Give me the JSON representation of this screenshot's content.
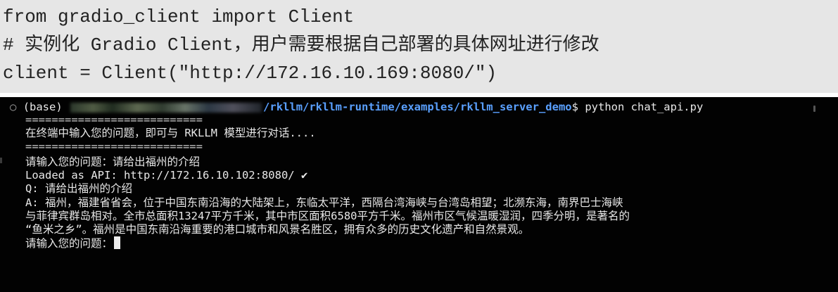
{
  "code": {
    "lines": [
      "from gradio_client import Client",
      "# 实例化 Gradio Client，用户需要根据自己部署的具体网址进行修改",
      "client = Client(\"http://172.16.10.169:8080/\")"
    ]
  },
  "terminal": {
    "prompt_indicator": "○",
    "env": "(base)",
    "path": "/rkllm/rkllm-runtime/examples/rkllm_server_demo",
    "prompt_symbol": "$",
    "command": "python chat_api.py",
    "separator": "===========================",
    "intro": "在终端中输入您的问题，即可与 RKLLM 模型进行对话....",
    "input_line_1": "请输入您的问题：请给出福州的介绍",
    "loaded_text": "Loaded as API: http://172.16.10.102:8080/",
    "loaded_check": "✔",
    "question": "Q: 请给出福州的介绍",
    "answer_lines": [
      "A: 福州，福建省省会，位于中国东南沿海的大陆架上，东临太平洋，西隔台湾海峡与台湾岛相望；北濒东海，南界巴士海峡",
      "与菲律宾群岛相对。全市总面积13247平方千米，其中市区面积6580平方千米。福州市区气候温暖湿润，四季分明，是著名的",
      "“鱼米之乡”。福州是中国东南沿海重要的港口城市和风景名胜区，拥有众多的历史文化遗产和自然景观。"
    ],
    "input_line_2": "请输入您的问题："
  }
}
